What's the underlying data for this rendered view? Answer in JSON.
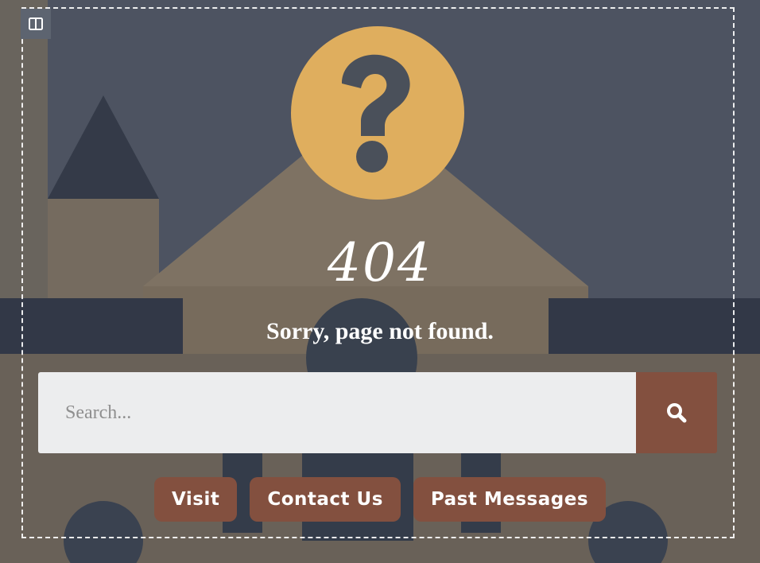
{
  "error": {
    "code": "404",
    "message": "Sorry, page not found."
  },
  "search": {
    "placeholder": "Search..."
  },
  "buttons": [
    {
      "label": "Visit"
    },
    {
      "label": "Contact Us"
    },
    {
      "label": "Past Messages"
    }
  ],
  "colors": {
    "accent": "#83503f",
    "icon_circle": "#dfae5e",
    "overlay": "#4a5260"
  },
  "icons": [
    "layout-toggle-icon",
    "question-mark-icon",
    "search-icon"
  ]
}
